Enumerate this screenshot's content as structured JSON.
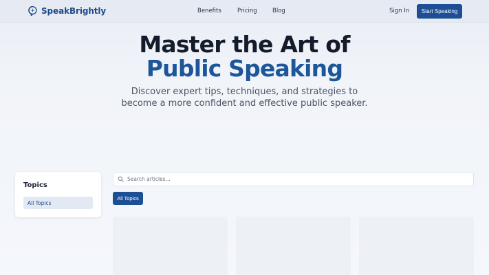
{
  "brand": {
    "name": "SpeakBrightly",
    "icon": "speech-bubble-sparkle-icon",
    "color": "#1f4a8a"
  },
  "nav": {
    "benefits": "Benefits",
    "pricing": "Pricing",
    "blog": "Blog"
  },
  "auth": {
    "sign_in": "Sign In",
    "cta": "Start Speaking"
  },
  "hero": {
    "title_line1": "Master the Art of",
    "title_line2": "Public Speaking",
    "subtitle": "Discover expert tips, techniques, and strategies to become a more confident and effective public speaker."
  },
  "sidebar": {
    "title": "Topics",
    "items": [
      {
        "label": "All Topics",
        "active": true
      }
    ]
  },
  "search": {
    "placeholder": "Search articles...",
    "value": "",
    "icon": "search-icon"
  },
  "filters": {
    "chips": [
      {
        "label": "All Topics",
        "active": true
      }
    ]
  },
  "colors": {
    "accent": "#1c4f96",
    "hero_accent": "#1d5699",
    "text": "#141c2c"
  }
}
